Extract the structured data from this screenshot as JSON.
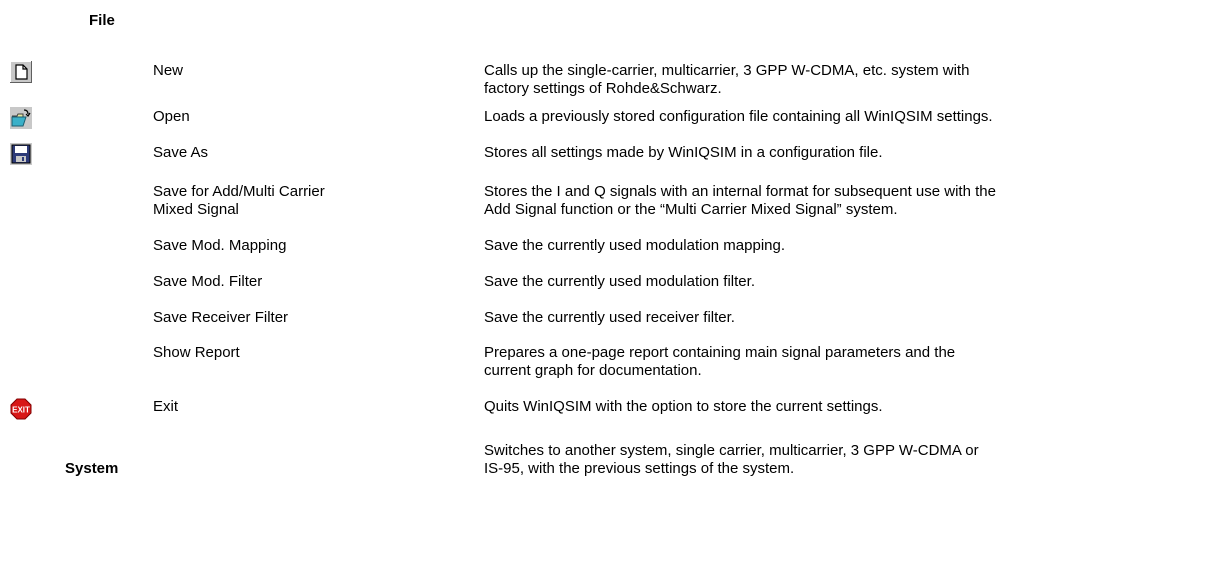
{
  "sections": {
    "file": "File",
    "system": "System"
  },
  "rows": [
    {
      "icon": "new-document-icon",
      "name": "New",
      "desc": "Calls up the single-carrier, multicarrier, 3 GPP W-CDMA, etc. system with\nfactory settings of Rohde&Schwarz."
    },
    {
      "icon": "open-folder-icon",
      "name": "Open",
      "desc": "Loads a previously stored configuration file containing all WinIQSIM settings."
    },
    {
      "icon": "floppy-disk-icon",
      "name": "Save As",
      "desc": "Stores all settings made by WinIQSIM in a configuration file."
    },
    {
      "icon": "",
      "name": "Save for Add/Multi Carrier\nMixed Signal",
      "desc": "Stores the I and Q signals with an internal format for subsequent use with the\nAdd Signal function or the “Multi Carrier Mixed Signal” system."
    },
    {
      "icon": "",
      "name": "Save Mod. Mapping",
      "desc": "Save the currently used modulation mapping."
    },
    {
      "icon": "",
      "name": "Save Mod. Filter",
      "desc": "Save the currently used modulation filter."
    },
    {
      "icon": "",
      "name": "Save Receiver Filter",
      "desc": "Save the currently used receiver filter."
    },
    {
      "icon": "",
      "name": "Show Report",
      "desc": "Prepares a one-page report containing main signal parameters and the\ncurrent graph for documentation."
    },
    {
      "icon": "exit-stop-icon",
      "name": "Exit",
      "desc": "Quits WinIQSIM with the option to store the current settings."
    }
  ],
  "system_desc": "Switches to another system, single carrier, multicarrier, 3 GPP W-CDMA or\nIS-95, with the previous settings of the system.",
  "exit_icon_text": "EXIT"
}
